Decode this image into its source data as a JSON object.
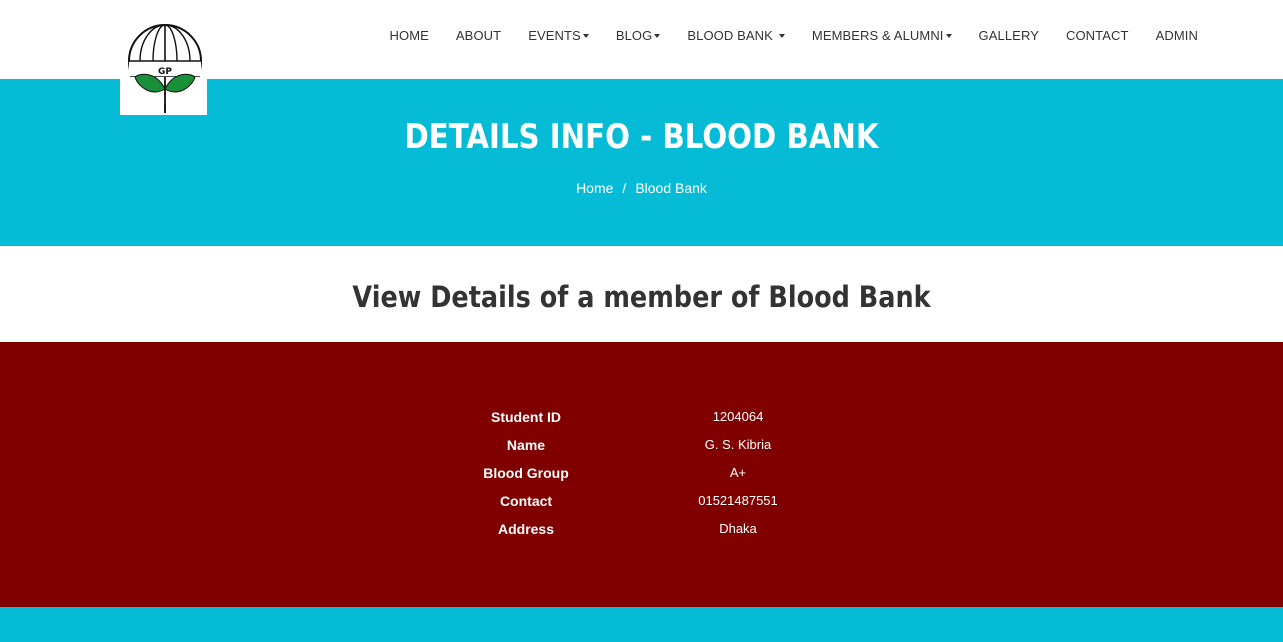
{
  "logo": {
    "text": "GP"
  },
  "nav": {
    "items": [
      {
        "label": "HOME",
        "dropdown": false
      },
      {
        "label": "ABOUT",
        "dropdown": false
      },
      {
        "label": "EVENTS",
        "dropdown": true
      },
      {
        "label": "BLOG",
        "dropdown": true
      },
      {
        "label": "BLOOD BANK",
        "dropdown": true
      },
      {
        "label": "MEMBERS & ALUMNI",
        "dropdown": true
      },
      {
        "label": "GALLERY",
        "dropdown": false
      },
      {
        "label": "CONTACT",
        "dropdown": false
      },
      {
        "label": "ADMIN",
        "dropdown": false
      }
    ]
  },
  "banner": {
    "title": "DETAILS INFO - BLOOD BANK",
    "breadcrumb": {
      "home": "Home",
      "separator": "/",
      "current": "Blood Bank"
    }
  },
  "section": {
    "heading": "View Details of a member of Blood Bank"
  },
  "details": {
    "rows": [
      {
        "label": "Student ID",
        "value": "1204064"
      },
      {
        "label": "Name",
        "value": "G. S. Kibria"
      },
      {
        "label": "Blood Group",
        "value": "A+"
      },
      {
        "label": "Contact",
        "value": "01521487551"
      },
      {
        "label": "Address",
        "value": "Dhaka"
      }
    ]
  },
  "colors": {
    "accent": "#05bbd6",
    "panel": "#800000",
    "text": "#333333",
    "logo_green": "#1a8f3a"
  }
}
